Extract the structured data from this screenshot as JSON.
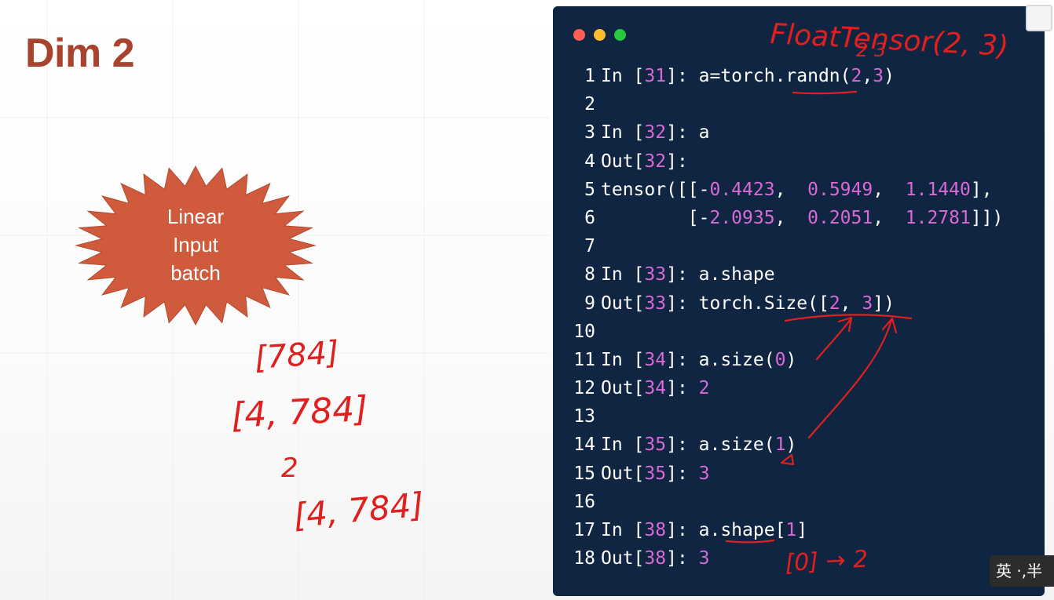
{
  "slide": {
    "title": "Dim 2",
    "shape_label_lines": [
      "Linear",
      "Input",
      "batch"
    ],
    "colors": {
      "title": "#a8432d",
      "burst": "#cf5a3c",
      "code_bg": "#0f2541",
      "number": "#d86ad6",
      "annotation": "#e0201e"
    }
  },
  "annotations": {
    "left": [
      "[784]",
      "[4, 784]",
      "2",
      "[4, 784]"
    ],
    "right_top": "FloatTensor(2, 3)",
    "right_top_sub": "2 3",
    "bottom": "[0] → 2"
  },
  "code_window": {
    "window_controls": [
      "close",
      "minimize",
      "maximize"
    ],
    "lines": [
      {
        "n": "1",
        "text": "In [31]: a=torch.randn(2,3)"
      },
      {
        "n": "2",
        "text": ""
      },
      {
        "n": "3",
        "text": "In [32]: a"
      },
      {
        "n": "4",
        "text": "Out[32]:"
      },
      {
        "n": "5",
        "text": "tensor([[-0.4423,  0.5949,  1.1440],"
      },
      {
        "n": "6",
        "text": "        [-2.0935,  0.2051,  1.2781]])"
      },
      {
        "n": "7",
        "text": ""
      },
      {
        "n": "8",
        "text": "In [33]: a.shape"
      },
      {
        "n": "9",
        "text": "Out[33]: torch.Size([2, 3])"
      },
      {
        "n": "10",
        "text": ""
      },
      {
        "n": "11",
        "text": "In [34]: a.size(0)"
      },
      {
        "n": "12",
        "text": "Out[34]: 2"
      },
      {
        "n": "13",
        "text": ""
      },
      {
        "n": "14",
        "text": "In [35]: a.size(1)"
      },
      {
        "n": "15",
        "text": "Out[35]: 3"
      },
      {
        "n": "16",
        "text": ""
      },
      {
        "n": "17",
        "text": "In [38]: a.shape[1]"
      },
      {
        "n": "18",
        "text": "Out[38]: 3"
      }
    ]
  },
  "ime_indicator": "英 ·,半"
}
